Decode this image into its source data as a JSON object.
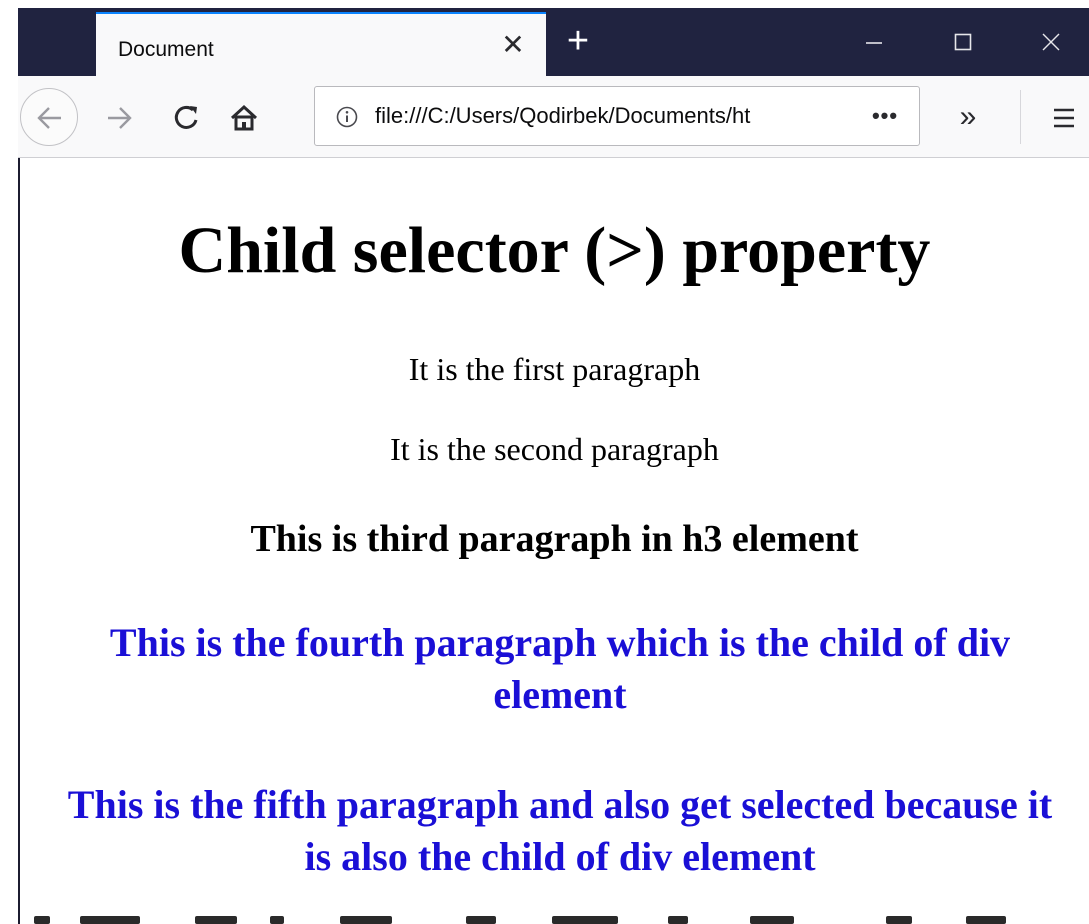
{
  "tab": {
    "title": "Document"
  },
  "icons": {
    "close_tab": "close-icon",
    "new_tab": "plus-icon",
    "minimize": "minimize-icon",
    "maximize": "maximize-icon",
    "close_window": "close-icon",
    "back": "arrow-left-icon",
    "forward": "arrow-right-icon",
    "reload": "reload-icon",
    "home": "home-icon",
    "info": "info-icon",
    "page_actions": "more-horizontal-icon",
    "overflow": "chevron-double-right-icon",
    "menu": "hamburger-icon"
  },
  "glyphs": {
    "close": "✕",
    "new_tab": "+",
    "page_actions": "•••",
    "overflow": "»"
  },
  "urlbar": {
    "url": "file:///C:/Users/Qodirbek/Documents/ht"
  },
  "content": {
    "heading": "Child selector (>) property",
    "para1": "It is the first paragraph",
    "para2": "It is the second paragraph",
    "h3": "This is third paragraph in h3 element",
    "para4": "This is the fourth paragraph which is the child of div element",
    "para5": "This is the fifth paragraph and also get selected because it is also the child of div element"
  },
  "colors": {
    "titlebar": "#202340",
    "tab_accent": "#0a84ff",
    "child_paragraph": "#1a0fd6",
    "text": "#000000"
  }
}
